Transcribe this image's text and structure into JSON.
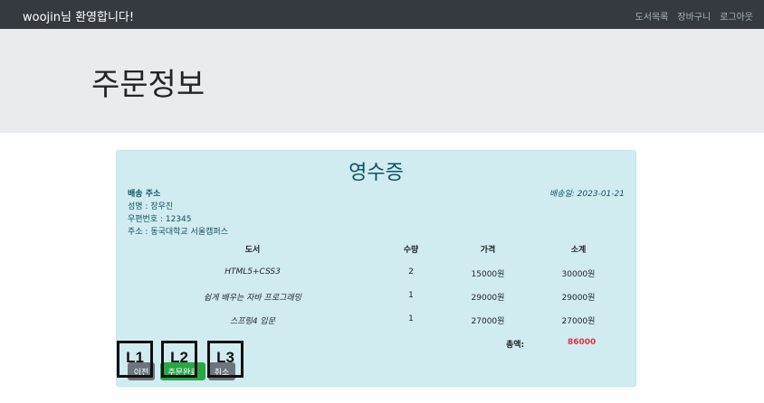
{
  "navbar": {
    "brand": "woojin님 환영합니다!",
    "links": [
      "도서목록",
      "장바구니",
      "로그아웃"
    ]
  },
  "jumbotron": {
    "title": "주문정보"
  },
  "receipt": {
    "title": "영수증",
    "shipping_heading": "배송 주소",
    "shipping_date": "배송일: 2023-01-21",
    "name": "성명 : 장우진",
    "zipcode": "우편번호 : 12345",
    "address": "주소 : 동국대학교 서울캠퍼스",
    "columns": [
      "도서",
      "수량",
      "가격",
      "소계"
    ],
    "rows": [
      [
        "HTML5+CSS3",
        "2",
        "15000원",
        "30000원"
      ],
      [
        "쉽게 배우는 자바 프로그래밍",
        "1",
        "29000원",
        "29000원"
      ],
      [
        "스프링4 입문",
        "1",
        "27000원",
        "27000원"
      ]
    ],
    "total_label": "총액:",
    "total_value": "86000"
  },
  "buttons": {
    "prev": "이전",
    "complete": "주문완료",
    "cancel": "취소"
  },
  "overlay_labels": [
    "L1",
    "L2",
    "L3"
  ],
  "colors": {
    "navbar": "#343a40",
    "receipt_bg": "#d1ecf1",
    "total": "#dc3545",
    "complete_button": "#28a745",
    "secondary_button": "#6c757d"
  }
}
